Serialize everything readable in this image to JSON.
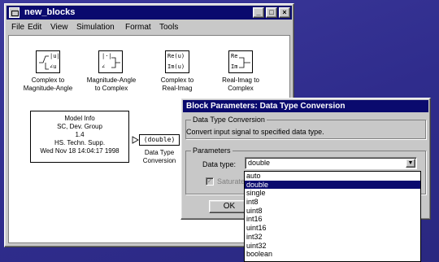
{
  "main_window": {
    "title": "new_blocks",
    "menu": [
      "File",
      "Edit",
      "View",
      "Simulation",
      "Format",
      "Tools"
    ],
    "blocks": [
      {
        "id": "c2ma",
        "label": "Complex to\nMagnitude-Angle",
        "icon_lines": [
          "|u|",
          "∠u"
        ]
      },
      {
        "id": "ma2c",
        "label": "Magnitude-Angle\nto Complex",
        "icon_lines": [
          "|·|",
          "∠"
        ]
      },
      {
        "id": "c2ri",
        "label": "Complex to\nReal-Imag",
        "icon_lines": [
          "Re(u)",
          "Im(u)"
        ]
      },
      {
        "id": "ri2c",
        "label": "Real-Imag to\nComplex",
        "icon_lines": [
          "Re",
          "Im"
        ]
      }
    ],
    "model_info": "Model Info\nSC, Dev. Group\n1.4\nHS. Techn. Supp.\nWed Nov 18 14:04:17 1998",
    "conversion_block": {
      "icon_text": "(double)",
      "label": "Data Type\nConversion"
    }
  },
  "dialog": {
    "title": "Block Parameters: Data Type  Conversion",
    "group_title": "Data Type Conversion",
    "description": "Convert input signal to specified data type.",
    "params_title": "Parameters",
    "data_type_label": "Data type:",
    "data_type_value": "double",
    "checkbox_label": "Saturate",
    "ok_label": "OK"
  },
  "dropdown": {
    "options": [
      "auto",
      "double",
      "single",
      "int8",
      "uint8",
      "int16",
      "uint16",
      "int32",
      "uint32",
      "boolean"
    ],
    "selected_index": 1
  }
}
